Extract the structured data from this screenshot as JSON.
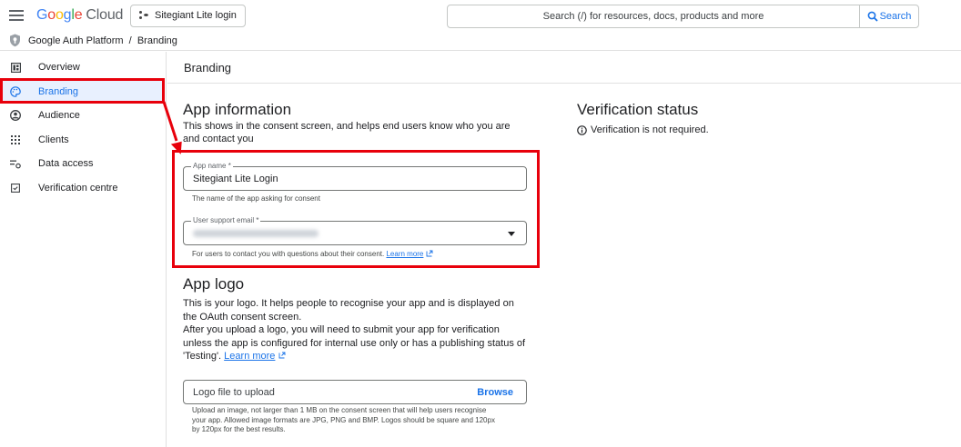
{
  "header": {
    "logo_letters": [
      "G",
      "o",
      "o",
      "g",
      "l",
      "e"
    ],
    "logo_suffix": "Cloud",
    "project": "Sitegiant Lite login",
    "search_placeholder": "Search (/) for resources, docs, products and more",
    "search_button": "Search"
  },
  "breadcrumb": {
    "text": "Google Auth Platform  /  Branding"
  },
  "sidebar": {
    "items": [
      {
        "label": "Overview",
        "icon": "dashboard-icon",
        "active": false
      },
      {
        "label": "Branding",
        "icon": "palette-icon",
        "active": true
      },
      {
        "label": "Audience",
        "icon": "account-circle-icon",
        "active": false
      },
      {
        "label": "Clients",
        "icon": "apps-grid-icon",
        "active": false
      },
      {
        "label": "Data access",
        "icon": "filter-settings-icon",
        "active": false
      },
      {
        "label": "Verification centre",
        "icon": "verified-box-icon",
        "active": false
      }
    ]
  },
  "main": {
    "title": "Branding",
    "app_info": {
      "heading": "App information",
      "description": "This shows in the consent screen, and helps end users know who you are and contact you",
      "app_name_label": "App name *",
      "app_name_value": "Sitegiant Lite Login",
      "app_name_hint": "The name of the app asking for consent",
      "support_email_label": "User support email *",
      "support_email_hint": "For users to contact you with questions about their consent.",
      "support_email_link": "Learn more"
    },
    "verification": {
      "heading": "Verification status",
      "text": "Verification is not required."
    },
    "app_logo": {
      "heading": "App logo",
      "line1": "This is your logo. It helps people to recognise your app and is displayed on the OAuth consent screen.",
      "line2": "After you upload a logo, you will need to submit your app for verification unless the app is configured for internal use only or has a publishing status of 'Testing'.",
      "link": "Learn more",
      "upload_placeholder": "Logo file to upload",
      "browse": "Browse",
      "upload_hint": "Upload an image, not larger than 1 MB on the consent screen that will help users recognise your app. Allowed image formats are JPG, PNG and BMP. Logos should be square and 120px by 120px for the best results."
    }
  },
  "colors": {
    "accent": "#1a73e8",
    "highlight": "#e8000b",
    "active_bg": "#e8f0fe"
  }
}
